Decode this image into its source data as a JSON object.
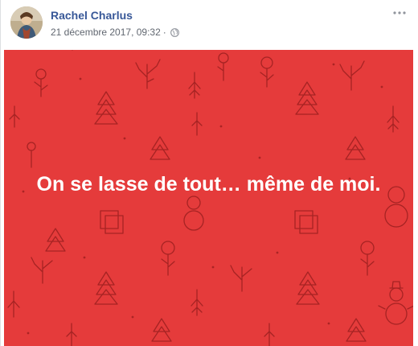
{
  "post": {
    "author": "Rachel Charlus",
    "timestamp": "21 décembre 2017, 09:32",
    "separator": "·",
    "privacy_icon": "globe-icon",
    "more_icon": "more-options-icon",
    "caption": "On se lasse de tout… même de moi."
  },
  "colors": {
    "background": "#e53b3b",
    "pattern_stroke": "#9c1f1f",
    "author_name": "#385898",
    "meta_text": "#616770"
  }
}
